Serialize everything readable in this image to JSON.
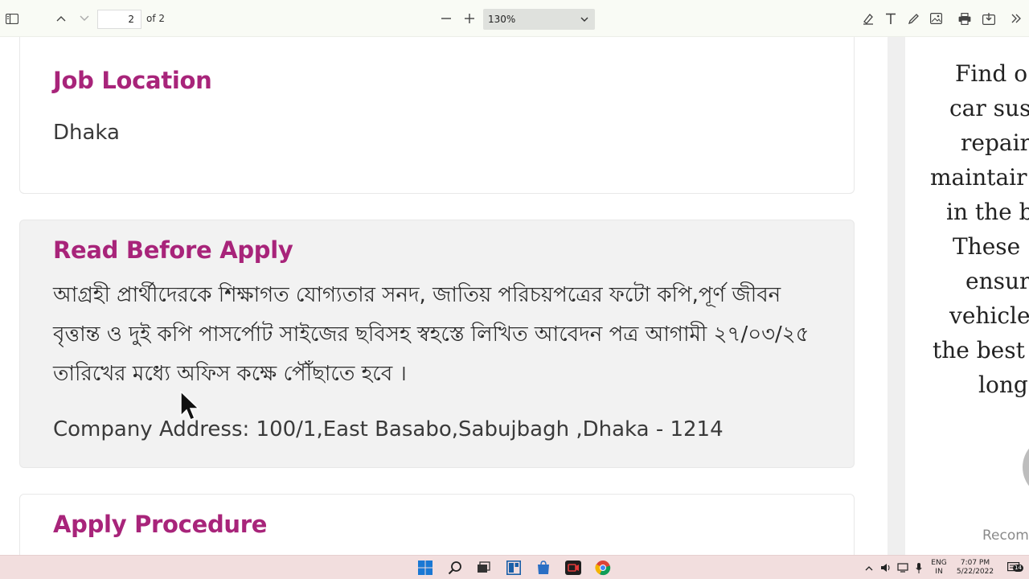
{
  "toolbar": {
    "page_current": "2",
    "page_of": "of 2",
    "zoom": "130%",
    "icons": [
      "sidebar-toggle-icon",
      "chevron-up-icon",
      "chevron-down-icon",
      "minus-icon",
      "plus-icon",
      "highlight-icon",
      "text-icon",
      "draw-icon",
      "image-icon",
      "print-icon",
      "save-icon",
      "more-icon"
    ]
  },
  "sections": {
    "job_location": {
      "heading": "Job Location",
      "value": "Dhaka"
    },
    "read_before": {
      "heading": "Read Before Apply",
      "bangla": "আগ্রহী প্রার্থীদেরকে শিক্ষাগত যোগ্যতার সনদ, জাতিয় পরিচয়পত্রের ফটো কপি,পূর্ণ জীবন বৃত্তান্ত ও দুই কপি পাসর্পোট সাইজের ছবিসহ স্বহস্তে লিখিত আবেদন পত্র আগামী ২৭/০৩/২৫ তারিখের মধ্যে অফিস কক্ষে পৌঁছাতে হবে ।",
      "address": "Company Address: 100/1,East Basabo,Sabujbagh ,Dhaka - 1214"
    },
    "apply": {
      "heading": "Apply Procedure"
    }
  },
  "side": {
    "lines": [
      "Find o",
      "car sus",
      "repair",
      "maintair",
      "in the b",
      "These",
      "ensur",
      "vehicle",
      "the best",
      "long"
    ],
    "recommend": "Recomm"
  },
  "taskbar": {
    "lang_top": "ENG",
    "lang_bottom": "IN",
    "time": "7:07 PM",
    "date": "5/22/2022",
    "notifications": "14"
  },
  "colors": {
    "heading": "#a8247a",
    "toolbar_bg": "#f9fbf5",
    "taskbar_bg": "#f2dede"
  }
}
